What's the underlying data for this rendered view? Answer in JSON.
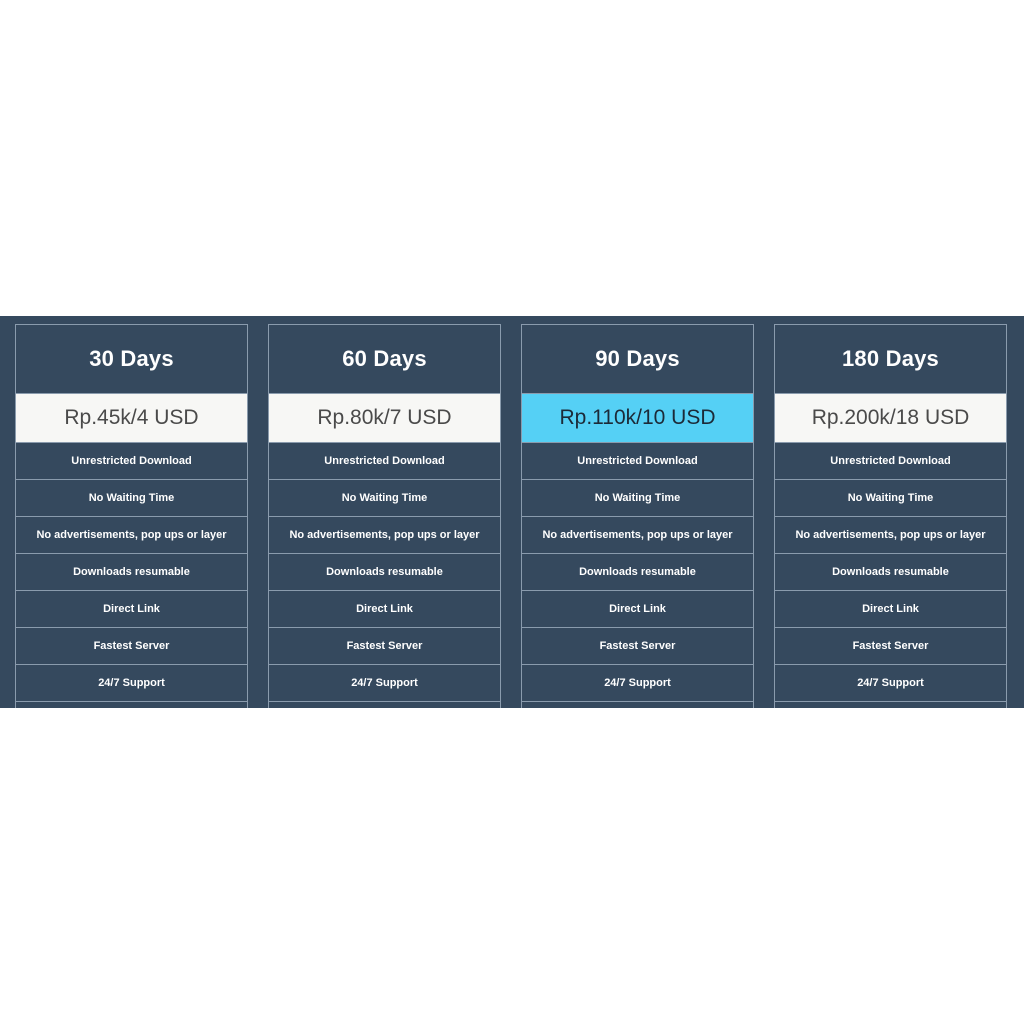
{
  "theme": {
    "banner_background": "#35495e",
    "card_border": "#8a9bad",
    "price_background": "#f7f7f5",
    "price_text": "#4a4a4a",
    "highlight_background": "#55d0f5",
    "highlight_text": "#1c2a38",
    "feature_text": "#ffffff",
    "page_background": "#ffffff"
  },
  "pricing_table": {
    "features": [
      "Unrestricted Download",
      "No Waiting Time",
      "No advertisements, pop ups or layer",
      "Downloads resumable",
      "Direct Link",
      "Fastest Server",
      "24/7  Support"
    ],
    "plans": [
      {
        "name": "30 Days",
        "price": "Rp.45k/4 USD",
        "highlighted": false
      },
      {
        "name": "60 Days",
        "price": "Rp.80k/7 USD",
        "highlighted": false
      },
      {
        "name": "90 Days",
        "price": "Rp.110k/10 USD",
        "highlighted": true
      },
      {
        "name": "180 Days",
        "price": "Rp.200k/18 USD",
        "highlighted": false
      }
    ]
  }
}
